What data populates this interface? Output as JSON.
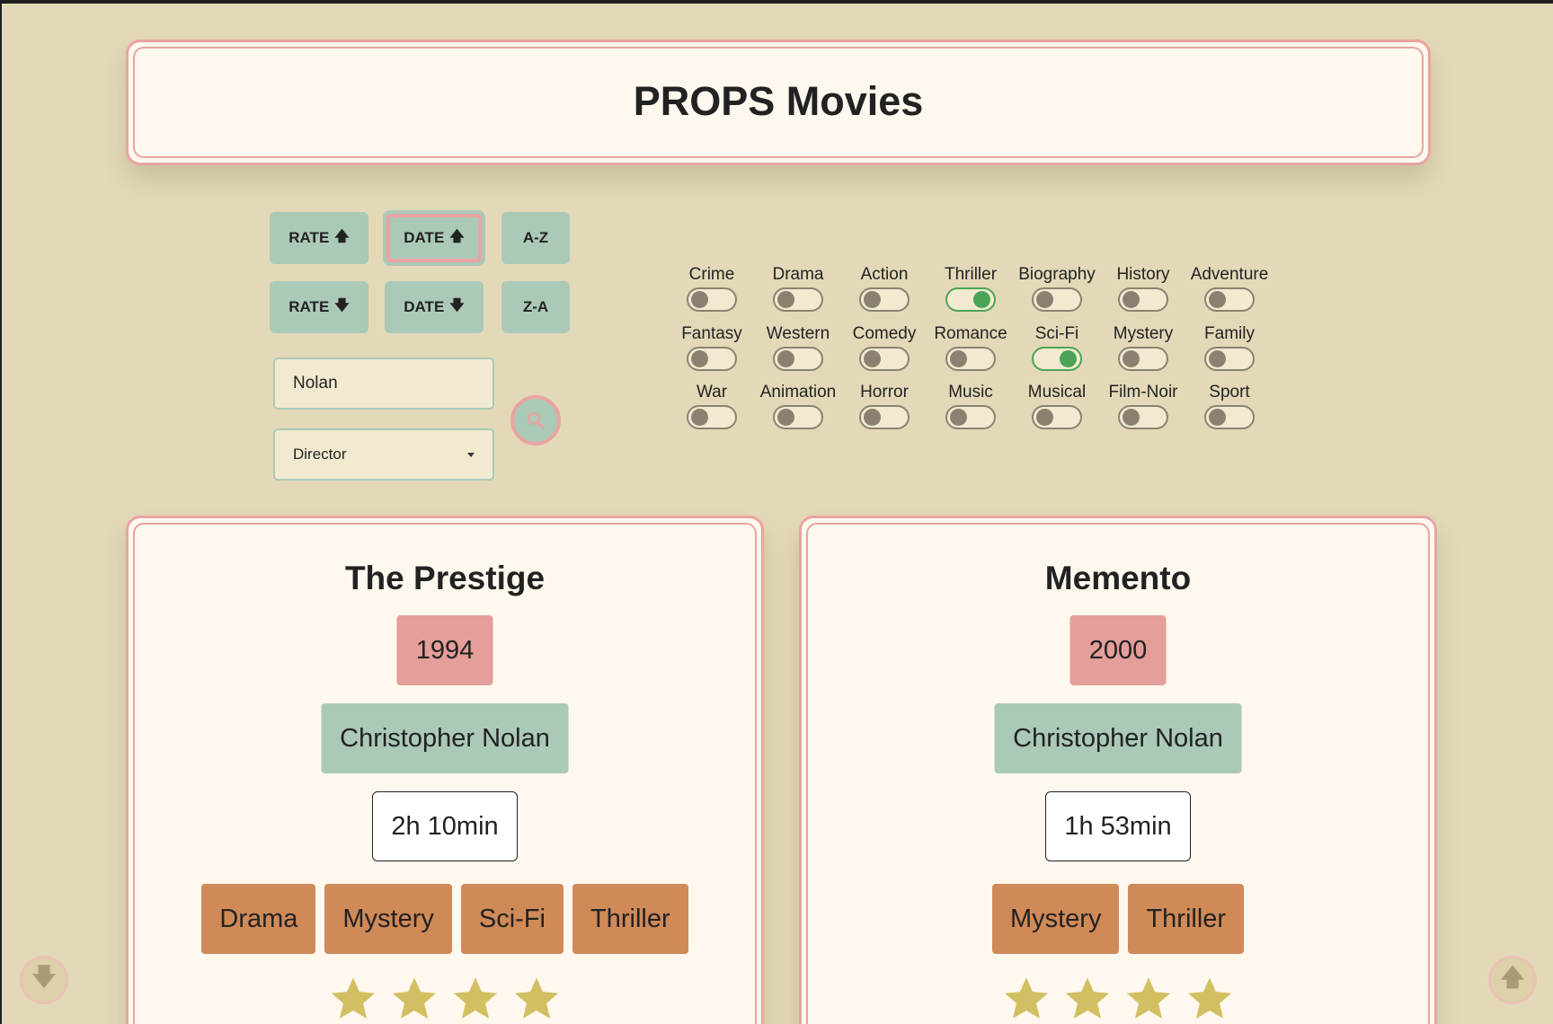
{
  "header": {
    "title": "PROPS Movies"
  },
  "sort": {
    "rate_up": "RATE",
    "date_up": "DATE",
    "az": "A-Z",
    "rate_down": "RATE",
    "date_down": "DATE",
    "za": "Z-A",
    "active": "date_up"
  },
  "search": {
    "value": "Nolan",
    "field_selected": "Director",
    "button_icon": "search-icon"
  },
  "genres": [
    {
      "label": "Crime",
      "on": false
    },
    {
      "label": "Drama",
      "on": false
    },
    {
      "label": "Action",
      "on": false
    },
    {
      "label": "Thriller",
      "on": true
    },
    {
      "label": "Biography",
      "on": false
    },
    {
      "label": "History",
      "on": false
    },
    {
      "label": "Adventure",
      "on": false
    },
    {
      "label": "Fantasy",
      "on": false
    },
    {
      "label": "Western",
      "on": false
    },
    {
      "label": "Comedy",
      "on": false
    },
    {
      "label": "Romance",
      "on": false
    },
    {
      "label": "Sci-Fi",
      "on": true
    },
    {
      "label": "Mystery",
      "on": false
    },
    {
      "label": "Family",
      "on": false
    },
    {
      "label": "War",
      "on": false
    },
    {
      "label": "Animation",
      "on": false
    },
    {
      "label": "Horror",
      "on": false
    },
    {
      "label": "Music",
      "on": false
    },
    {
      "label": "Musical",
      "on": false
    },
    {
      "label": "Film-Noir",
      "on": false
    },
    {
      "label": "Sport",
      "on": false
    }
  ],
  "movies": [
    {
      "title": "The Prestige",
      "year": "1994",
      "director": "Christopher Nolan",
      "runtime": "2h 10min",
      "genres": [
        "Drama",
        "Mystery",
        "Sci-Fi",
        "Thriller"
      ],
      "stars": 4
    },
    {
      "title": "Memento",
      "year": "2000",
      "director": "Christopher Nolan",
      "runtime": "1h 53min",
      "genres": [
        "Mystery",
        "Thriller"
      ],
      "stars": 4
    }
  ],
  "colors": {
    "background": "#e3d9b9",
    "card": "#fff8ee",
    "accent_pink": "#e8a4a1",
    "accent_green": "#abc9b7",
    "genre_tag": "#d08a58",
    "star": "#d2bf62",
    "toggle_on": "#4aa456"
  },
  "scroll": {
    "down_icon": "arrow-down-icon",
    "up_icon": "arrow-up-icon"
  }
}
